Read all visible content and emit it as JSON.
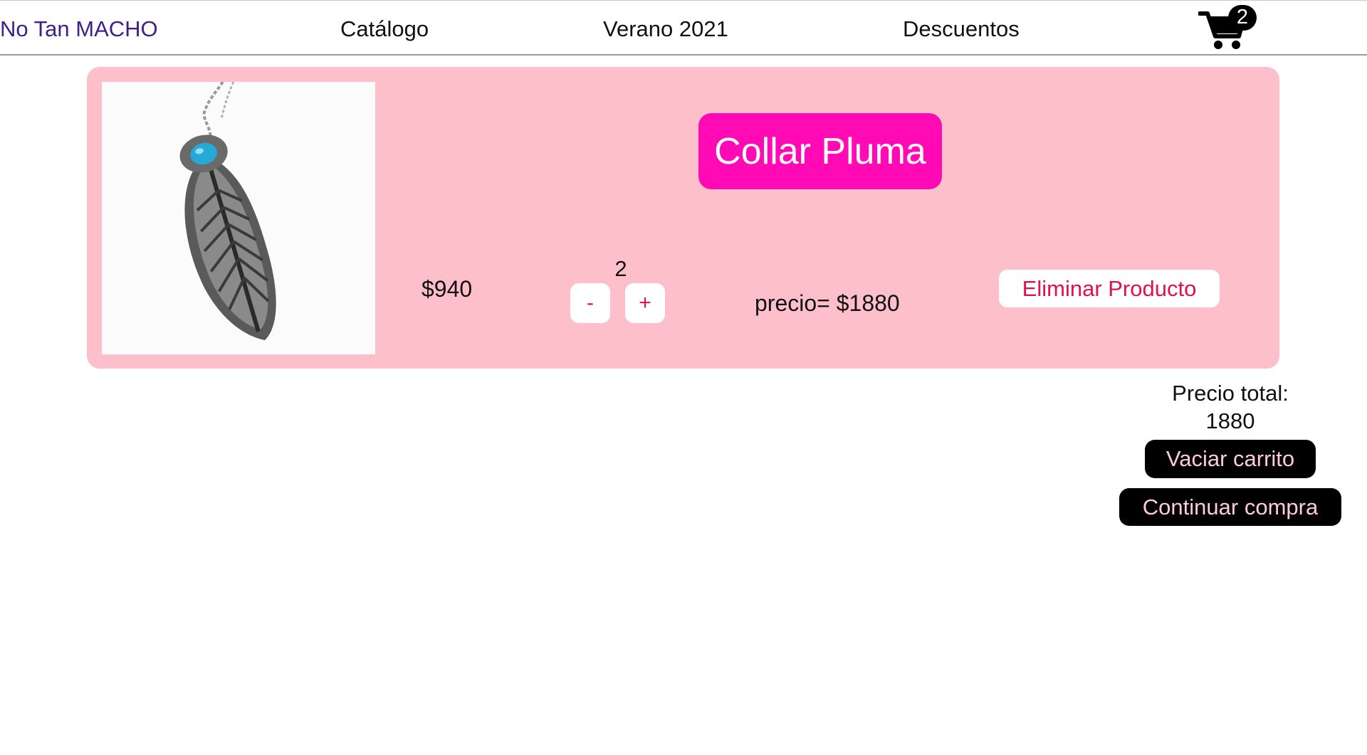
{
  "nav": {
    "brand": "No Tan MACHO",
    "links": [
      "Catálogo",
      "Verano 2021",
      "Descuentos"
    ],
    "cart_count": "2",
    "cart_icon": "shopping-cart-icon"
  },
  "cart_item": {
    "title": "Collar Pluma",
    "unit_price": "$940",
    "quantity": "2",
    "decrement_label": "-",
    "increment_label": "+",
    "line_total": "precio= $1880",
    "remove_label": "Eliminar Producto",
    "image": "feather-necklace-image"
  },
  "summary": {
    "total_label": "Precio total:",
    "total_value": "1880",
    "empty_cart_label": "Vaciar carrito",
    "checkout_label": "Continuar compra"
  },
  "colors": {
    "brand_text": "#3e1f8c",
    "card_bg": "#fdc0cb",
    "title_bg": "#ff0ab4",
    "accent_text": "#e8163e",
    "dark_button": "#000000",
    "dark_button_text": "#fbcbd6"
  }
}
